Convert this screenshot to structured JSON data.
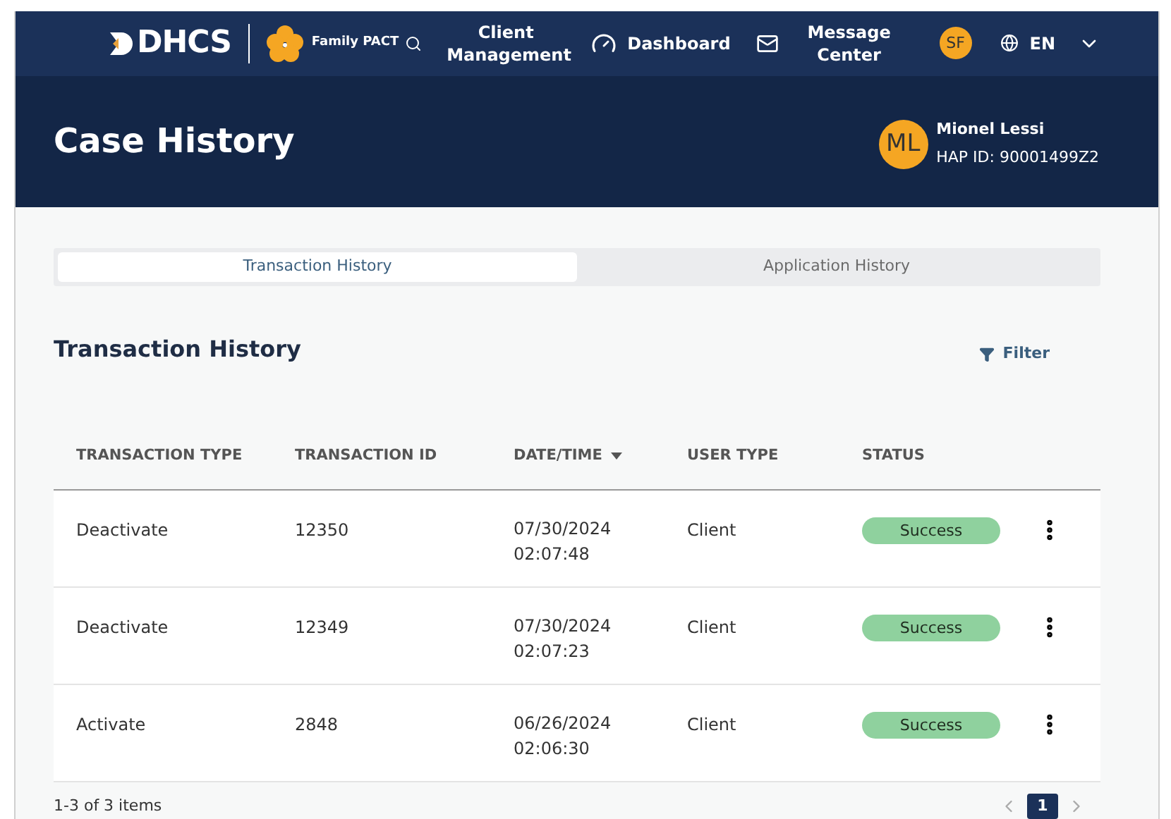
{
  "nav": {
    "logo": "DHCS",
    "program": "Family PACT",
    "items": [
      {
        "label": "Client Management"
      },
      {
        "label": "Dashboard"
      },
      {
        "label": "Message Center"
      }
    ],
    "user_initials": "SF",
    "language": "EN"
  },
  "header": {
    "title": "Case History",
    "initials": "ML",
    "name": "Mionel Lessi",
    "hap_id": "HAP ID: 90001499Z2"
  },
  "tabs": [
    {
      "label": "Transaction History",
      "selected": true
    },
    {
      "label": "Application History",
      "selected": false
    }
  ],
  "section": {
    "title": "Transaction History",
    "filter": "Filter"
  },
  "table": {
    "columns": [
      {
        "label": "TRANSACTION TYPE",
        "sorted": false
      },
      {
        "label": "TRANSACTION ID",
        "sorted": false
      },
      {
        "label": "DATE/TIME",
        "sorted": true
      },
      {
        "label": "USER TYPE",
        "sorted": false
      },
      {
        "label": "STATUS",
        "sorted": false
      }
    ],
    "rows": [
      {
        "type": "Deactivate",
        "id": "12350",
        "datetime": "07/30/2024 02:07:48",
        "user_type": "Client",
        "status": "Success",
        "color": "#8fd19e"
      },
      {
        "type": "Deactivate",
        "id": "12349",
        "datetime": "07/30/2024 02:07:23",
        "user_type": "Client",
        "status": "Success",
        "color": "#8fd19e"
      },
      {
        "type": "Activate",
        "id": "2848",
        "datetime": "06/26/2024 02:06:30",
        "user_type": "Client",
        "status": "Success",
        "color": "#8fd19e"
      }
    ]
  },
  "pagination": {
    "summary": "1-3 of 3 items",
    "pages": [
      {
        "label": "1",
        "selected": true
      }
    ]
  }
}
